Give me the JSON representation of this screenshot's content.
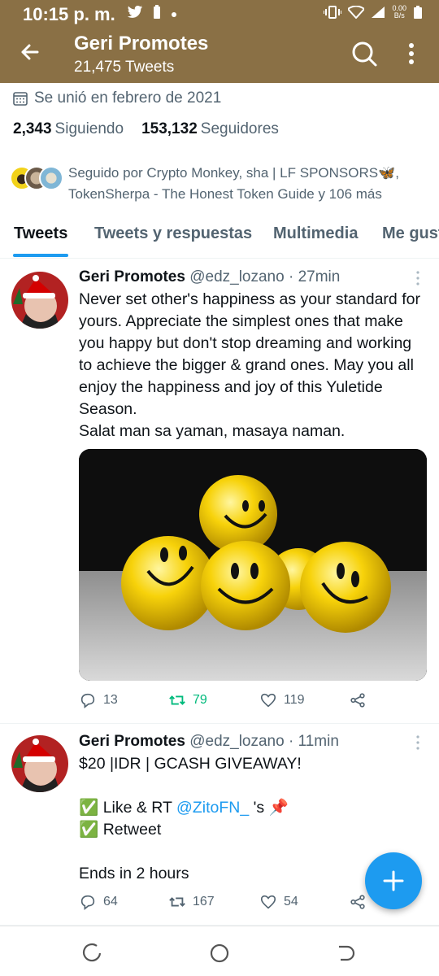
{
  "status_bar": {
    "time": "10:15 p. m.",
    "net_speed_value": "0.00",
    "net_speed_unit": "B/s"
  },
  "header": {
    "title": "Geri Promotes",
    "subtitle": "21,475 Tweets"
  },
  "profile": {
    "joined": "Se unió en febrero de 2021",
    "following_count": "2,343",
    "following_label": "Siguiendo",
    "followers_count": "153,132",
    "followers_label": "Seguidores",
    "followed_by": "Seguido por Crypto Monkey, sha | LF SPONSORS🦋, TokenSherpa - The Honest Token Guide y 106 más"
  },
  "tabs": [
    "Tweets",
    "Tweets y respuestas",
    "Multimedia",
    "Me gusta"
  ],
  "tweets": [
    {
      "name": "Geri Promotes",
      "meta": "@edz_lozano · 27min",
      "lines": [
        "Never set other's happiness as your standard for yours.  Appreciate the simplest ones that make you happy but don't stop dreaming and working to achieve the bigger & grand ones. May you all enjoy the happiness and joy of this Yuletide Season.",
        "Salat man sa yaman, masaya naman."
      ],
      "replies": "13",
      "retweets": "79",
      "likes": "119"
    },
    {
      "name": "Geri Promotes",
      "meta": "@edz_lozano · 11min",
      "line1": "$20 |IDR | GCASH GIVEAWAY!",
      "line2_pre": "✅ Like & RT ",
      "line2_mention": "@ZitoFN_",
      "line2_post": " 's 📌",
      "line3": "✅ Retweet",
      "line4": "Ends in 2 hours",
      "replies": "64",
      "retweets": "167",
      "likes": "54"
    }
  ],
  "colors": {
    "header_bg": "#8a7045",
    "accent": "#1d9bf0",
    "retweet_active": "#00ba7c"
  }
}
